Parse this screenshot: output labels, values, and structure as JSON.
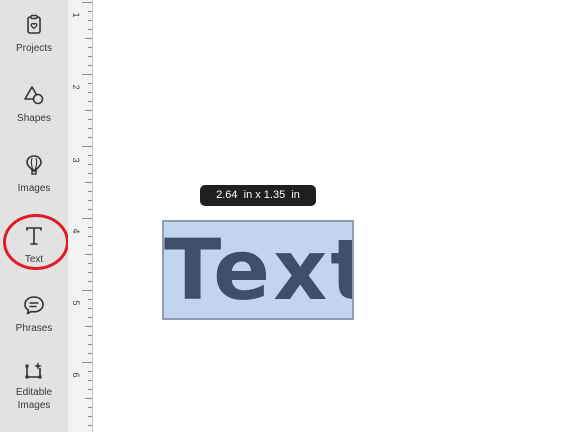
{
  "sidebar": {
    "items": [
      {
        "label": "Projects",
        "icon": "projects-icon"
      },
      {
        "label": "Shapes",
        "icon": "shapes-icon"
      },
      {
        "label": "Images",
        "icon": "images-icon"
      },
      {
        "label": "Text",
        "icon": "text-icon"
      },
      {
        "label": "Phrases",
        "icon": "phrases-icon"
      },
      {
        "label": "Editable Images",
        "icon": "editable-images-icon"
      }
    ],
    "highlighted_item": "Text",
    "highlight_color": "#e01b24"
  },
  "ruler": {
    "numbers": [
      "1",
      "2",
      "3",
      "4",
      "5",
      "6"
    ]
  },
  "canvas": {
    "dimension_badge": "2.64  in x 1.35  in",
    "text_object": {
      "text": "Text",
      "fill_color": "#3e4e6b",
      "selection_color": "#c3d5ee"
    }
  }
}
